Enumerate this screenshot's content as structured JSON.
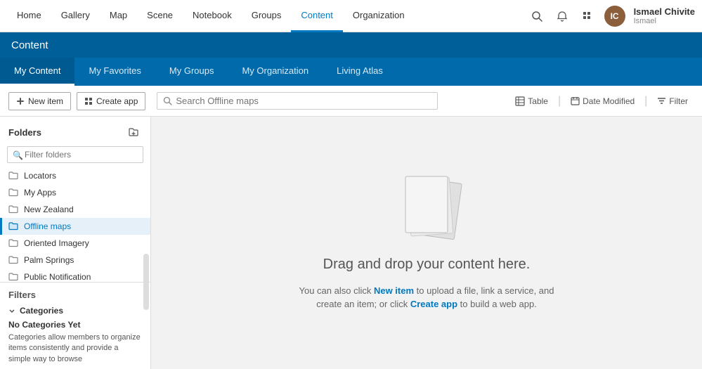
{
  "topNav": {
    "items": [
      {
        "label": "Home",
        "active": false
      },
      {
        "label": "Gallery",
        "active": false
      },
      {
        "label": "Map",
        "active": false
      },
      {
        "label": "Scene",
        "active": false
      },
      {
        "label": "Notebook",
        "active": false
      },
      {
        "label": "Groups",
        "active": false
      },
      {
        "label": "Content",
        "active": true
      },
      {
        "label": "Organization",
        "active": false
      }
    ],
    "user": {
      "name": "Ismael Chivite",
      "sub": "Ismael",
      "initials": "IC"
    }
  },
  "contentHeader": {
    "title": "Content"
  },
  "subNav": {
    "items": [
      {
        "label": "My Content",
        "active": true
      },
      {
        "label": "My Favorites",
        "active": false
      },
      {
        "label": "My Groups",
        "active": false
      },
      {
        "label": "My Organization",
        "active": false
      },
      {
        "label": "Living Atlas",
        "active": false
      }
    ]
  },
  "toolbar": {
    "newItemLabel": "New item",
    "createAppLabel": "Create app",
    "searchPlaceholder": "Search Offline maps",
    "tableLabel": "Table",
    "dateModifiedLabel": "Date Modified",
    "filterLabel": "Filter"
  },
  "sidebar": {
    "foldersTitle": "Folders",
    "filterPlaceholder": "Filter folders",
    "folders": [
      {
        "name": "Locators",
        "active": false
      },
      {
        "name": "My Apps",
        "active": false
      },
      {
        "name": "New Zealand",
        "active": false
      },
      {
        "name": "Offline maps",
        "active": true
      },
      {
        "name": "Oriented Imagery",
        "active": false
      },
      {
        "name": "Palm Springs",
        "active": false
      },
      {
        "name": "Public Notification",
        "active": false
      }
    ],
    "filtersTitle": "Filters",
    "categoriesTitle": "Categories",
    "noCategoriesText": "No Categories Yet",
    "categoriesDesc": "Categories allow members to organize items consistently and provide a simple way to browse"
  },
  "emptyState": {
    "title": "Drag and drop your content here.",
    "descPart1": "You can also click ",
    "newItemLink": "New item",
    "descPart2": " to upload a file, link a service, and create an item; or click ",
    "createAppLink": "Create app",
    "descPart3": " to build a web app."
  }
}
